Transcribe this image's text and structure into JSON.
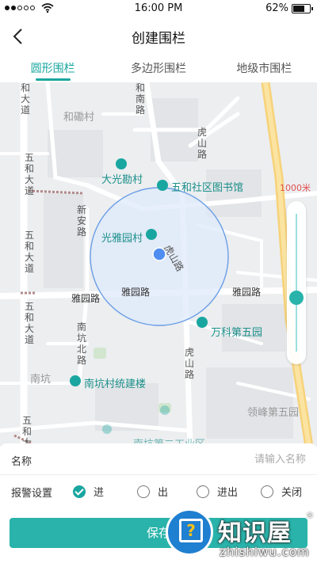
{
  "status_bar": {
    "time": "16:00 PM",
    "battery": "62%",
    "battery_level": 0.62
  },
  "header": {
    "title": "创建围栏",
    "back_icon": "chevron-left-icon"
  },
  "tabs": [
    {
      "label": "圆形围栏",
      "active": true
    },
    {
      "label": "多边形围栏",
      "active": false
    },
    {
      "label": "地级市围栏",
      "active": false
    }
  ],
  "map": {
    "scale_label": "1000米",
    "zoom_level": 0.45,
    "labels": {
      "hedadao_top": "和大道",
      "helicun": "和磡村",
      "henanlu": "和南路",
      "wuhedadao_left": "五和大道",
      "wuhedadao_left2": "五和大道",
      "wuhedadao_left3": "五和大道",
      "wuhedadao_bottom": "五和大",
      "huluntop": "虎山路",
      "daguangkan": "大光勘村",
      "library": "五和社区图书馆",
      "xinanlu": "新安路",
      "guangya": "光雅园村",
      "hushanlu_mid": "虎山路",
      "yayuanlu_mid": "雅园路",
      "yayuanlu_left": "雅园路",
      "yayuanlu_right": "雅园路",
      "vanke": "万科第五园",
      "nankengbei": "南坑北路",
      "hushanlu_bottom": "虎山路",
      "nankeng": "南坑",
      "nankengcun": "南坑村统建楼",
      "lingfeng": "领峰第五园",
      "bottom_partial": "南坑第二工业区"
    }
  },
  "form": {
    "name_label": "名称",
    "name_placeholder": "请输入名称",
    "name_value": "",
    "alarm_label": "报警设置",
    "alarm_options": [
      {
        "label": "进",
        "selected": true
      },
      {
        "label": "出",
        "selected": false
      },
      {
        "label": "进出",
        "selected": false
      },
      {
        "label": "关闭",
        "selected": false
      }
    ],
    "save_label": "保存"
  },
  "watermark": {
    "cn": "知识屋",
    "en": "zhishiwu.com",
    "reg": "®",
    "badge_icon": "question-monitor-icon"
  },
  "colors": {
    "accent": "#29b3aa",
    "fence_fill": "#dfe9fb",
    "fence_stroke": "#6a9ee6",
    "center_dot": "#4f8ef0",
    "scale_text": "#e05050"
  }
}
